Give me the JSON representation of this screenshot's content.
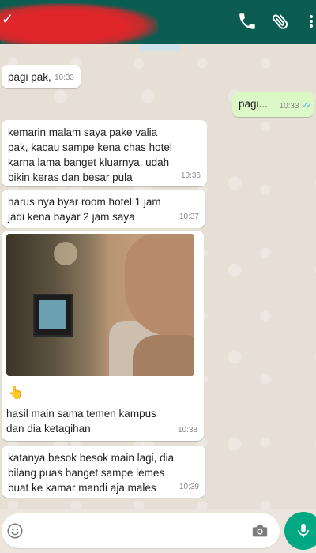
{
  "header": {
    "back_icon": "arrow-left-icon",
    "contact_name": "",
    "call_icon": "phone-icon",
    "attach_icon": "paperclip-icon",
    "menu_icon": "more-vertical-icon",
    "color": "#0b5c51"
  },
  "messages": [
    {
      "direction": "in",
      "text": "pagi pak,",
      "time": "10:33"
    },
    {
      "direction": "out",
      "text": "pagi...",
      "time": "10:33",
      "status": "read"
    },
    {
      "direction": "in",
      "text": "kemarin malam saya pake valia\npak, kacau  sampe kena chas hotel\nkarna lama banget kluarnya, udah\nbikin keras dan besar pula",
      "time": "10:36"
    },
    {
      "direction": "in",
      "text": "harus nya byar room hotel 1 jam\njadi kena bayar 2 jam saya",
      "time": "10:37"
    },
    {
      "direction": "in",
      "type": "image",
      "emoji": "👆",
      "caption": "hasil main sama temen kampus\ndan dia ketagihan",
      "time": "10:38"
    },
    {
      "direction": "in",
      "text": "katanya besok besok main lagi, dia\nbilang puas banget sampe lemes\nbuat ke kamar mandi aja males",
      "time": "10:39"
    }
  ],
  "input": {
    "placeholder": "",
    "emoji_icon": "smiley-icon",
    "camera_icon": "camera-icon",
    "mic_icon": "microphone-icon",
    "accent": "#00a884"
  },
  "colors": {
    "incoming_bubble": "#ffffff",
    "outgoing_bubble": "#dcf8c6",
    "read_ticks": "#4fb6ec",
    "chat_background": "#e6dfd5"
  }
}
